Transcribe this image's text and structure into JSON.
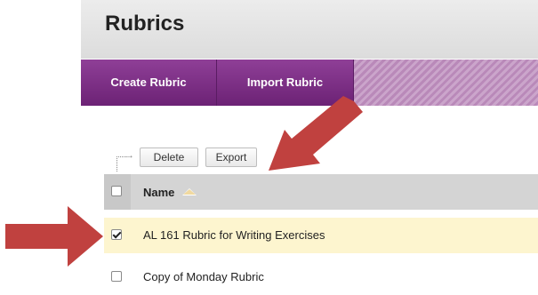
{
  "page": {
    "title": "Rubrics"
  },
  "action_bar": {
    "create_label": "Create Rubric",
    "import_label": "Import Rubric"
  },
  "toolbar": {
    "delete_label": "Delete",
    "export_label": "Export"
  },
  "table": {
    "columns": [
      {
        "label": "Name",
        "sort": "ascending"
      }
    ],
    "rows": [
      {
        "name": "AL 161 Rubric for Writing Exercises",
        "checked": true
      },
      {
        "name": "Copy of Monday Rubric",
        "checked": false
      }
    ]
  },
  "colors": {
    "action_bar": "#7a2a84",
    "selected_row": "#fdf5cf",
    "annotation_arrow": "#c0413f"
  },
  "icons": [
    "sort-ascending-icon",
    "checkbox-icon",
    "connector-arrow-icon",
    "annotation-arrow"
  ]
}
